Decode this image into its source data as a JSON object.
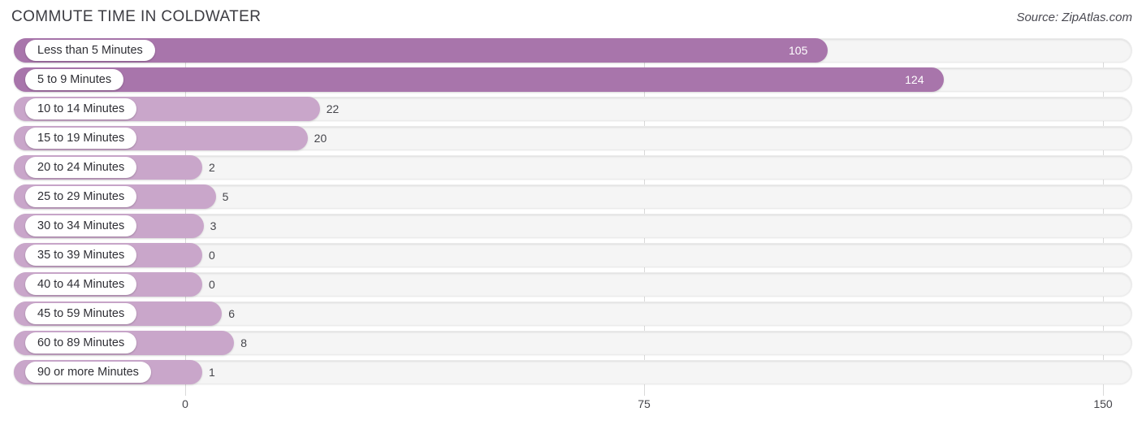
{
  "header": {
    "title": "COMMUTE TIME IN COLDWATER",
    "source": "Source: ZipAtlas.com"
  },
  "colors": {
    "bar_strong": "#a875ab",
    "bar_light": "#c9a6ca",
    "track": "#f5f5f5",
    "gridline": "#d9d9d9",
    "value_text_inside": "#ffffff",
    "value_text_outside": "#45454b"
  },
  "chart_data": {
    "type": "bar",
    "orientation": "horizontal",
    "title": "COMMUTE TIME IN COLDWATER",
    "xlabel": "",
    "ylabel": "",
    "xlim": [
      0,
      150
    ],
    "xticks": [
      0,
      75,
      150
    ],
    "xtick_labels": [
      "0",
      "75",
      "150"
    ],
    "grid": true,
    "legend": false,
    "categories": [
      "Less than 5 Minutes",
      "5 to 9 Minutes",
      "10 to 14 Minutes",
      "15 to 19 Minutes",
      "20 to 24 Minutes",
      "25 to 29 Minutes",
      "30 to 34 Minutes",
      "35 to 39 Minutes",
      "40 to 44 Minutes",
      "45 to 59 Minutes",
      "60 to 89 Minutes",
      "90 or more Minutes"
    ],
    "values": [
      105,
      124,
      22,
      20,
      2,
      5,
      3,
      0,
      0,
      6,
      8,
      1
    ],
    "value_labels": [
      "105",
      "124",
      "22",
      "20",
      "2",
      "5",
      "3",
      "0",
      "0",
      "6",
      "8",
      "1"
    ]
  }
}
